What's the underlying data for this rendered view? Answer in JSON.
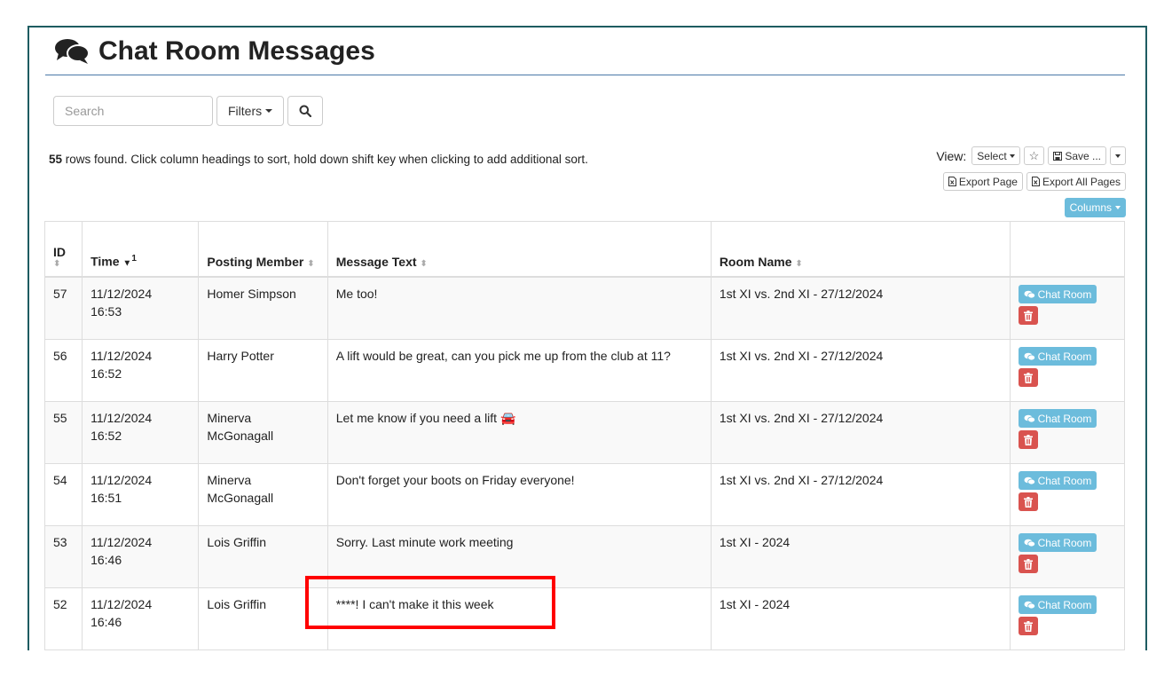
{
  "header": {
    "title": "Chat Room Messages"
  },
  "search": {
    "placeholder": "Search",
    "filters_label": "Filters"
  },
  "info": {
    "row_count": "55",
    "message": " rows found. Click column headings to sort, hold down shift key when clicking to add additional sort."
  },
  "view": {
    "label": "View:",
    "select_label": "Select",
    "save_label": "Save ...",
    "export_page": "Export Page",
    "export_all": "Export All Pages",
    "columns": "Columns"
  },
  "table": {
    "headers": {
      "id": "ID",
      "time": "Time",
      "time_sort_order": "1",
      "member": "Posting Member",
      "message": "Message Text",
      "room": "Room Name"
    },
    "action_label": "Chat Room",
    "rows": [
      {
        "id": "57",
        "date": "11/12/2024",
        "clock": "16:53",
        "member": "Homer Simpson",
        "message": "Me too!",
        "room": "1st XI vs. 2nd XI - 27/12/2024"
      },
      {
        "id": "56",
        "date": "11/12/2024",
        "clock": "16:52",
        "member": "Harry Potter",
        "message": "A lift would be great, can you pick me up from the club at 11?",
        "room": "1st XI vs. 2nd XI - 27/12/2024"
      },
      {
        "id": "55",
        "date": "11/12/2024",
        "clock": "16:52",
        "member": "Minerva McGonagall",
        "message": "Let me know if you need a lift 🚘",
        "room": "1st XI vs. 2nd XI - 27/12/2024"
      },
      {
        "id": "54",
        "date": "11/12/2024",
        "clock": "16:51",
        "member": "Minerva McGonagall",
        "message": "Don't forget your boots on Friday everyone!",
        "room": "1st XI vs. 2nd XI - 27/12/2024"
      },
      {
        "id": "53",
        "date": "11/12/2024",
        "clock": "16:46",
        "member": "Lois Griffin",
        "message": "Sorry. Last minute work meeting",
        "room": "1st XI - 2024"
      },
      {
        "id": "52",
        "date": "11/12/2024",
        "clock": "16:46",
        "member": "Lois Griffin",
        "message": "****! I can't make it this week",
        "room": "1st XI - 2024"
      }
    ]
  },
  "colors": {
    "frame": "#1e5c61",
    "info_button": "#6cbcdc",
    "danger_button": "#d9534f",
    "highlight": "#ff0000"
  }
}
